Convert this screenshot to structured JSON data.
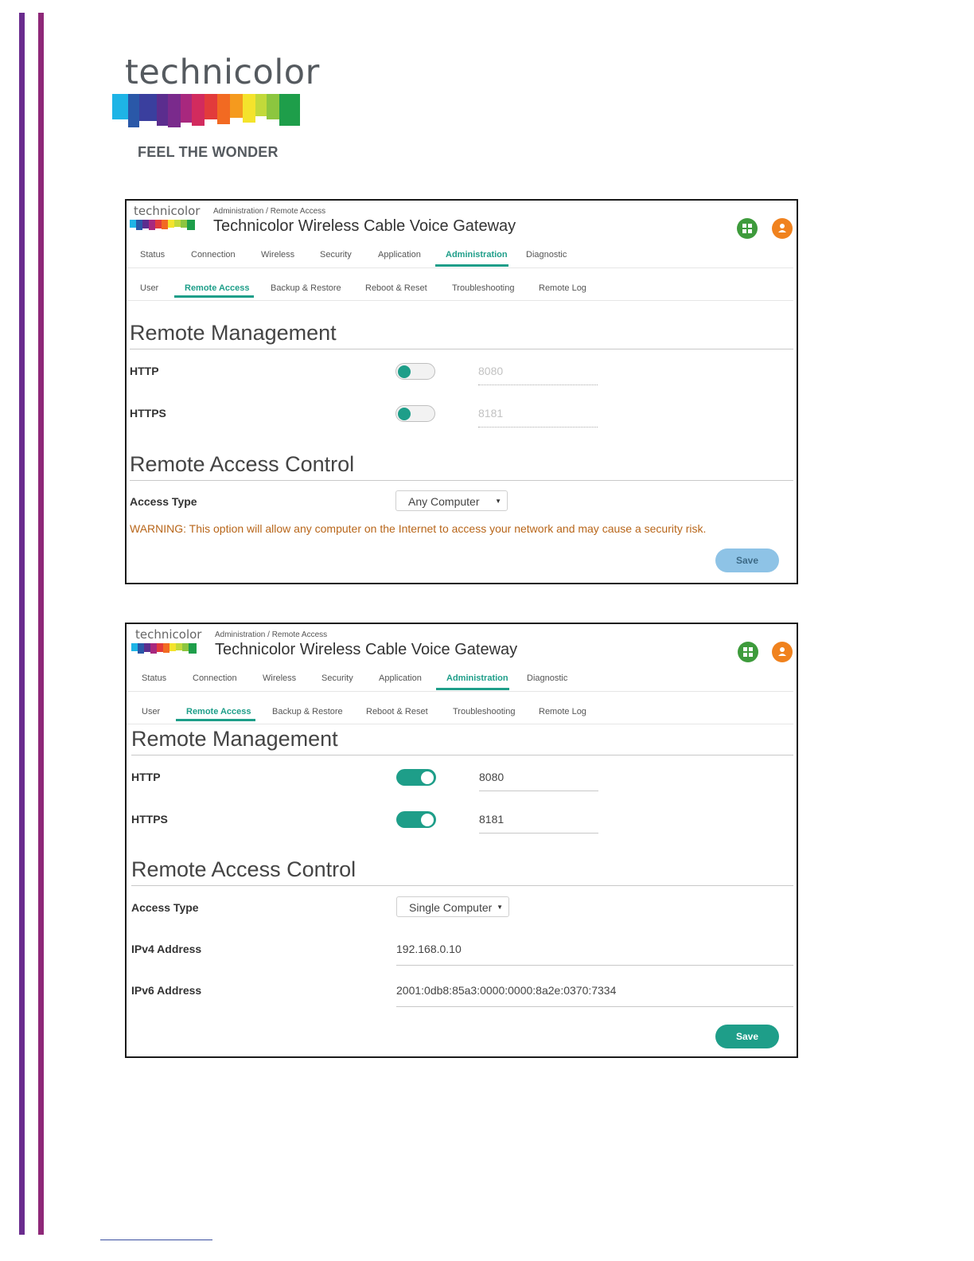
{
  "brand": {
    "logo_text": "technicolor",
    "tagline": "FEEL THE WONDER",
    "band_colors": [
      "#1eb4e6",
      "#2a58a8",
      "#6a2c8e",
      "#c0267e",
      "#e23b3b",
      "#f59a1e",
      "#f4e32c",
      "#8cc63f",
      "#1e9e4a"
    ]
  },
  "panels": [
    {
      "mini_logo": "technicolor",
      "breadcrumb": "Administration / Remote Access",
      "title": "Technicolor Wireless Cable Voice Gateway",
      "nav": [
        "Status",
        "Connection",
        "Wireless",
        "Security",
        "Application",
        "Administration",
        "Diagnostic"
      ],
      "active_nav": "Administration",
      "subnav": [
        "User",
        "Remote Access",
        "Backup & Restore",
        "Reboot & Reset",
        "Troubleshooting",
        "Remote Log"
      ],
      "active_subnav": "Remote Access",
      "section_remote_management": "Remote Management",
      "http_label": "HTTP",
      "http_enabled": false,
      "http_port": "8080",
      "https_label": "HTTPS",
      "https_enabled": false,
      "https_port": "8181",
      "section_access_control": "Remote Access Control",
      "access_type_label": "Access Type",
      "access_type_value": "Any Computer",
      "warning": "WARNING: This option will allow any computer on the Internet to access your network and may cause a security risk.",
      "save_label": "Save"
    },
    {
      "mini_logo": "technicolor",
      "breadcrumb": "Administration / Remote Access",
      "title": "Technicolor Wireless Cable Voice Gateway",
      "nav": [
        "Status",
        "Connection",
        "Wireless",
        "Security",
        "Application",
        "Administration",
        "Diagnostic"
      ],
      "active_nav": "Administration",
      "subnav": [
        "User",
        "Remote Access",
        "Backup & Restore",
        "Reboot & Reset",
        "Troubleshooting",
        "Remote Log"
      ],
      "active_subnav": "Remote Access",
      "section_remote_management": "Remote Management",
      "http_label": "HTTP",
      "http_enabled": true,
      "http_port": "8080",
      "https_label": "HTTPS",
      "https_enabled": true,
      "https_port": "8181",
      "section_access_control": "Remote Access Control",
      "access_type_label": "Access Type",
      "access_type_value": "Single Computer",
      "ipv4_label": "IPv4 Address",
      "ipv4_value": "192.168.0.10",
      "ipv6_label": "IPv6 Address",
      "ipv6_value": "2001:0db8:85a3:0000:0000:8a2e:0370:7334",
      "save_label": "Save"
    }
  ],
  "colors": {
    "accent": "#1e9e89",
    "warning": "#b8661a",
    "grid_icon": "#3e9b3c",
    "user_icon": "#f0821e",
    "save_disabled": "#8ec3e6"
  },
  "icons": {
    "apps": "grid-icon",
    "account": "user-icon",
    "dropdown": "caret-down-icon"
  }
}
